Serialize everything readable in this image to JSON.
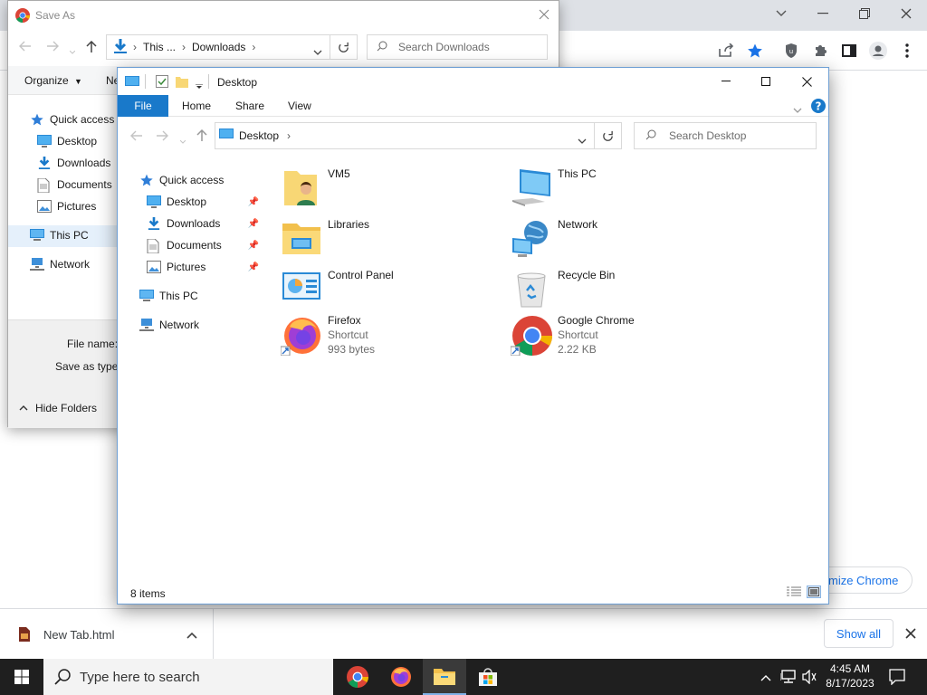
{
  "chrome": {
    "window_controls": [
      "chevron-down",
      "minimize",
      "restore",
      "close"
    ],
    "customize_button": "mize Chrome",
    "download_shelf": {
      "file_name": "New Tab.html",
      "show_all": "Show all"
    }
  },
  "saveas": {
    "title": "Save As",
    "address": {
      "segments": [
        "This ...",
        "Downloads"
      ]
    },
    "search_placeholder": "Search Downloads",
    "cmdbar": {
      "organize": "Organize",
      "new_folder": "Ne"
    },
    "nav": [
      {
        "label": "Quick access",
        "icon": "star-icon"
      },
      {
        "label": "Desktop",
        "icon": "desktop-icon"
      },
      {
        "label": "Downloads",
        "icon": "download-icon"
      },
      {
        "label": "Documents",
        "icon": "documents-icon"
      },
      {
        "label": "Pictures",
        "icon": "pictures-icon"
      },
      {
        "label": "This PC",
        "icon": "pc-icon"
      },
      {
        "label": "Network",
        "icon": "network-icon"
      }
    ],
    "footer": {
      "file_name_label": "File name:",
      "save_as_type_label": "Save as type:",
      "hide_folders": "Hide Folders"
    }
  },
  "explorer": {
    "title": "Desktop",
    "ribbon_tabs": [
      "File",
      "Home",
      "Share",
      "View"
    ],
    "address": "Desktop",
    "search_placeholder": "Search Desktop",
    "nav": [
      {
        "label": "Quick access",
        "pinned": false
      },
      {
        "label": "Desktop",
        "pinned": true
      },
      {
        "label": "Downloads",
        "pinned": true
      },
      {
        "label": "Documents",
        "pinned": true
      },
      {
        "label": "Pictures",
        "pinned": true
      },
      {
        "label": "This PC",
        "pinned": false
      },
      {
        "label": "Network",
        "pinned": false
      }
    ],
    "items": [
      {
        "name": "VM5",
        "icon": "user-folder-icon"
      },
      {
        "name": "This PC",
        "icon": "this-pc-icon"
      },
      {
        "name": "Libraries",
        "icon": "libraries-icon"
      },
      {
        "name": "Network",
        "icon": "network-globe-icon"
      },
      {
        "name": "Control Panel",
        "icon": "control-panel-icon"
      },
      {
        "name": "Recycle Bin",
        "icon": "recycle-bin-icon"
      },
      {
        "name": "Firefox",
        "type": "Shortcut",
        "size": "993 bytes",
        "icon": "firefox-icon"
      },
      {
        "name": "Google Chrome",
        "type": "Shortcut",
        "size": "2.22 KB",
        "icon": "chrome-icon"
      }
    ],
    "status": "8 items"
  },
  "taskbar": {
    "search_placeholder": "Type here to search",
    "time": "4:45 AM",
    "date": "8/17/2023"
  },
  "colors": {
    "accent": "#1979ca",
    "chrome_blue": "#1a73e8",
    "taskbar": "#1f1f1f",
    "folder_yellow": "#f8d775"
  }
}
